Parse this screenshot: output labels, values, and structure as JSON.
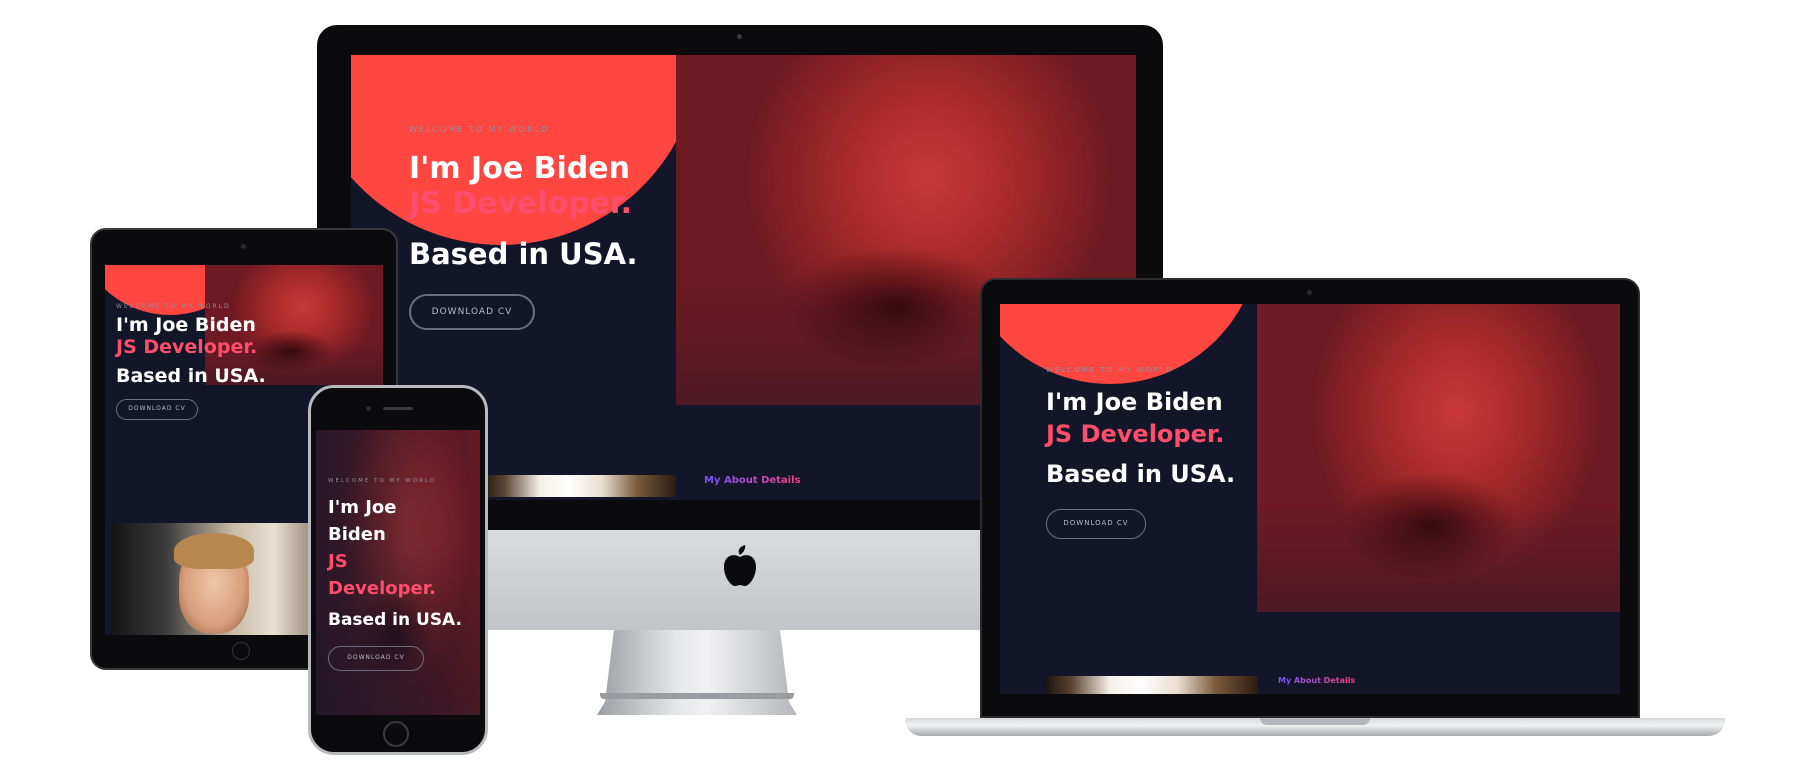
{
  "hero": {
    "welcome": "WELCOME TO MY WORLD",
    "name": "I'm Joe Biden",
    "role": "JS Developer.",
    "based": "Based in USA.",
    "download_label": "DOWNLOAD CV"
  },
  "phone": {
    "name_line1": "I'm Joe",
    "name_line2": "Biden",
    "role_line1": "JS",
    "role_line2": "Developer."
  },
  "about_link": "My About Details",
  "colors": {
    "accent_red": "#ff4641",
    "accent_pink": "#ff4e6b",
    "background_navy": "#131629"
  },
  "icons": [
    "apple-logo-icon"
  ]
}
